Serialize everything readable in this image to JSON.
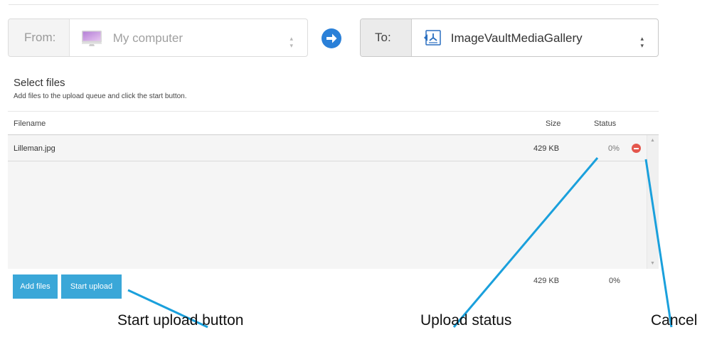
{
  "from": {
    "label": "From:",
    "value": "My computer",
    "icon": "imac-icon"
  },
  "to": {
    "label": "To:",
    "value": "ImageVaultMediaGallery",
    "icon": "imagevault-logo-icon"
  },
  "section": {
    "title": "Select files",
    "subtitle": "Add files to the upload queue and click the start button."
  },
  "table": {
    "columns": {
      "filename": "Filename",
      "size": "Size",
      "status": "Status"
    },
    "rows": [
      {
        "filename": "Lilleman.jpg",
        "size": "429 KB",
        "status": "0%"
      }
    ],
    "footer": {
      "size": "429 KB",
      "status": "0%"
    }
  },
  "buttons": {
    "add": "Add files",
    "start": "Start upload"
  },
  "annotations": {
    "start_upload": "Start upload button",
    "upload_status": "Upload status",
    "cancel": "Cancel"
  },
  "colors": {
    "accent": "#3aa7d8",
    "arrow": "#2a80d8",
    "cancel": "#e4574d",
    "callout_line": "#1aa0dc"
  }
}
